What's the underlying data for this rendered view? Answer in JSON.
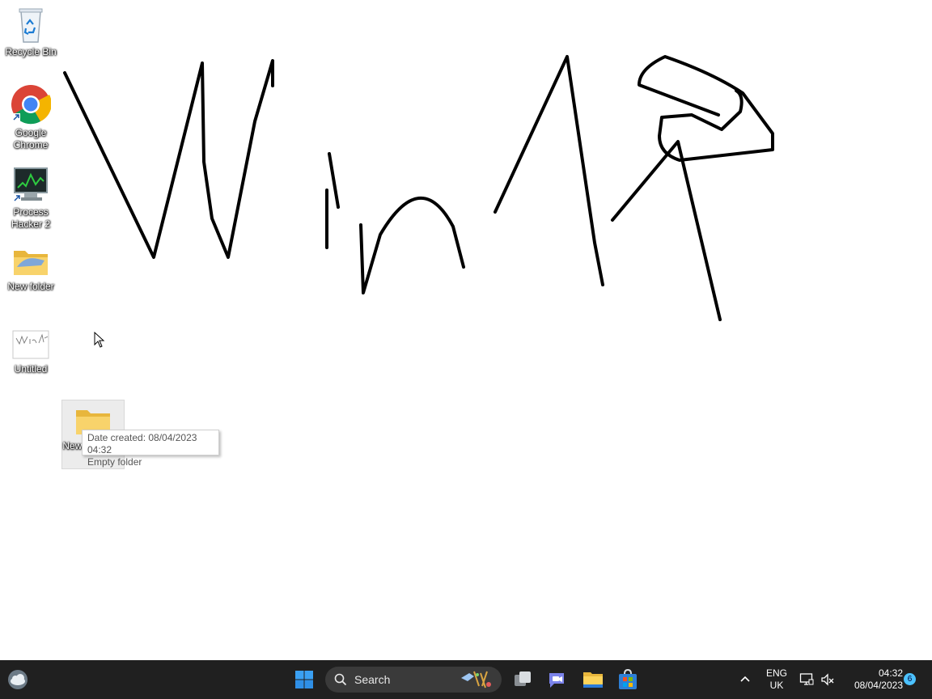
{
  "desktop": {
    "icons": [
      {
        "label": "Recycle Bin"
      },
      {
        "label": "Google Chrome"
      },
      {
        "label": "Process Hacker 2"
      },
      {
        "label": "New folder"
      },
      {
        "label": "Untitled"
      },
      {
        "label": "New folder (2)"
      }
    ],
    "tooltip": {
      "date_created": "Date created: 08/04/2023 04:32",
      "description": "Empty folder"
    }
  },
  "taskbar": {
    "search_label": "Search",
    "language": "ENG",
    "region": "UK",
    "time": "04:32",
    "date": "08/04/2023",
    "notification_count": "6",
    "accent_color": "#0078d4"
  }
}
